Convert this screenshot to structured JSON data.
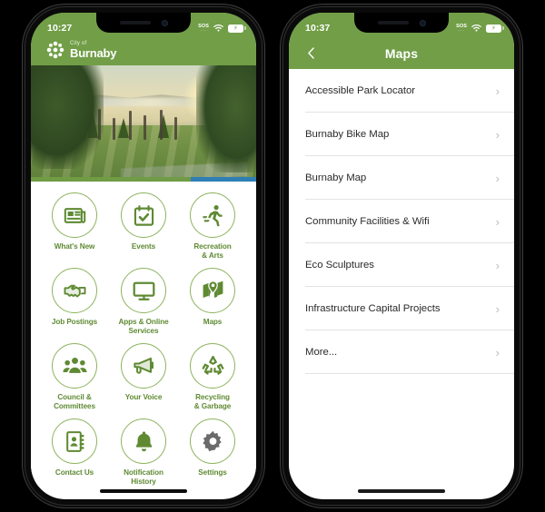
{
  "phones": {
    "left": {
      "status": {
        "time": "10:27",
        "sos": "SOS",
        "sos_sub": "····",
        "wifi": "wifi-icon",
        "battery": "battery-charging-icon"
      },
      "header": {
        "logo_line1": "City of",
        "logo_line2": "Burnaby",
        "crest": "burnaby-crest-icon"
      },
      "hero": {
        "alt": "park-at-sunset-photo"
      },
      "tiles": [
        {
          "label": "What's New",
          "icon": "newspaper-icon",
          "color": "#5f8a33"
        },
        {
          "label": "Events",
          "icon": "calendar-check-icon",
          "color": "#5f8a33"
        },
        {
          "label": "Recreation\n& Arts",
          "label_l1": "Recreation",
          "label_l2": "& Arts",
          "icon": "runner-icon",
          "color": "#5f8a33"
        },
        {
          "label": "Job Postings",
          "icon": "handshake-icon",
          "color": "#5f8a33"
        },
        {
          "label": "Apps & Online\nServices",
          "label_l1": "Apps & Online",
          "label_l2": "Services",
          "icon": "monitor-icon",
          "color": "#5f8a33"
        },
        {
          "label": "Maps",
          "icon": "map-pin-icon",
          "color": "#5f8a33"
        },
        {
          "label": "Council &\nCommittees",
          "label_l1": "Council &",
          "label_l2": "Committees",
          "icon": "people-group-icon",
          "color": "#5f8a33"
        },
        {
          "label": "Your Voice",
          "icon": "megaphone-icon",
          "color": "#5f8a33"
        },
        {
          "label": "Recycling\n& Garbage",
          "label_l1": "Recycling",
          "label_l2": "& Garbage",
          "icon": "recycle-icon",
          "color": "#5f8a33"
        },
        {
          "label": "Contact Us",
          "icon": "address-book-icon",
          "color": "#5f8a33"
        },
        {
          "label": "Notification\nHistory",
          "label_l1": "Notification",
          "label_l2": "History",
          "icon": "bell-icon",
          "color": "#5f8a33"
        },
        {
          "label": "Settings",
          "icon": "gear-icon",
          "color": "#6b6b6b"
        }
      ]
    },
    "right": {
      "status": {
        "time": "10:37",
        "sos": "SOS",
        "sos_sub": "····",
        "wifi": "wifi-icon",
        "battery": "battery-charging-icon"
      },
      "nav": {
        "title": "Maps",
        "back_icon": "chevron-left-icon"
      },
      "list": [
        {
          "label": "Accessible Park Locator",
          "chevron": "›"
        },
        {
          "label": "Burnaby Bike Map",
          "chevron": "›"
        },
        {
          "label": "Burnaby Map",
          "chevron": "›"
        },
        {
          "label": "Community Facilities & Wifi",
          "chevron": "›"
        },
        {
          "label": "Eco Sculptures",
          "chevron": "›"
        },
        {
          "label": "Infrastructure Capital Projects",
          "chevron": "›"
        },
        {
          "label": "More...",
          "chevron": "›"
        }
      ]
    }
  },
  "theme": {
    "brand_green": "#719E47",
    "icon_green": "#5f8a33",
    "circle_border": "#8db35f",
    "gear_gray": "#6b6b6b",
    "page_bg": "#000000",
    "accent_blue": "#2f7fb5"
  }
}
